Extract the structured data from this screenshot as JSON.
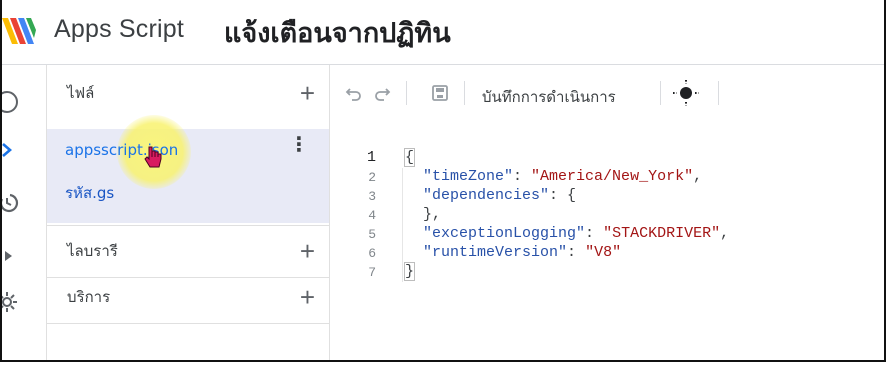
{
  "header": {
    "app_name": "Apps Script",
    "project_title": "แจ้งเตือนจากปฏิทิน"
  },
  "sidebar": {
    "files_label": "ไฟล์",
    "files": [
      {
        "name": "appsscript.json",
        "active": true
      },
      {
        "name": "รหัส.gs",
        "active": false
      }
    ],
    "libraries_label": "ไลบรารี",
    "services_label": "บริการ"
  },
  "toolbar": {
    "execution_log_label": "บันทึกการดำเนินการ"
  },
  "editor": {
    "lines": [
      {
        "n": "1",
        "text": "{"
      },
      {
        "n": "2",
        "key": "\"timeZone\"",
        "sep": ": ",
        "value": "\"America/New_York\"",
        "end": ","
      },
      {
        "n": "3",
        "key": "\"dependencies\"",
        "sep": ": {",
        "value": "",
        "end": ""
      },
      {
        "n": "4",
        "text": "  },"
      },
      {
        "n": "5",
        "key": "\"exceptionLogging\"",
        "sep": ": ",
        "value": "\"STACKDRIVER\"",
        "end": ","
      },
      {
        "n": "6",
        "key": "\"runtimeVersion\"",
        "sep": ": ",
        "value": "\"V8\"",
        "end": ""
      },
      {
        "n": "7",
        "text": "}"
      }
    ]
  },
  "colors": {
    "accent": "#1a73e8",
    "selected_bg": "#e8eaf6",
    "json_key": "#2851a8",
    "json_string": "#a31515"
  }
}
